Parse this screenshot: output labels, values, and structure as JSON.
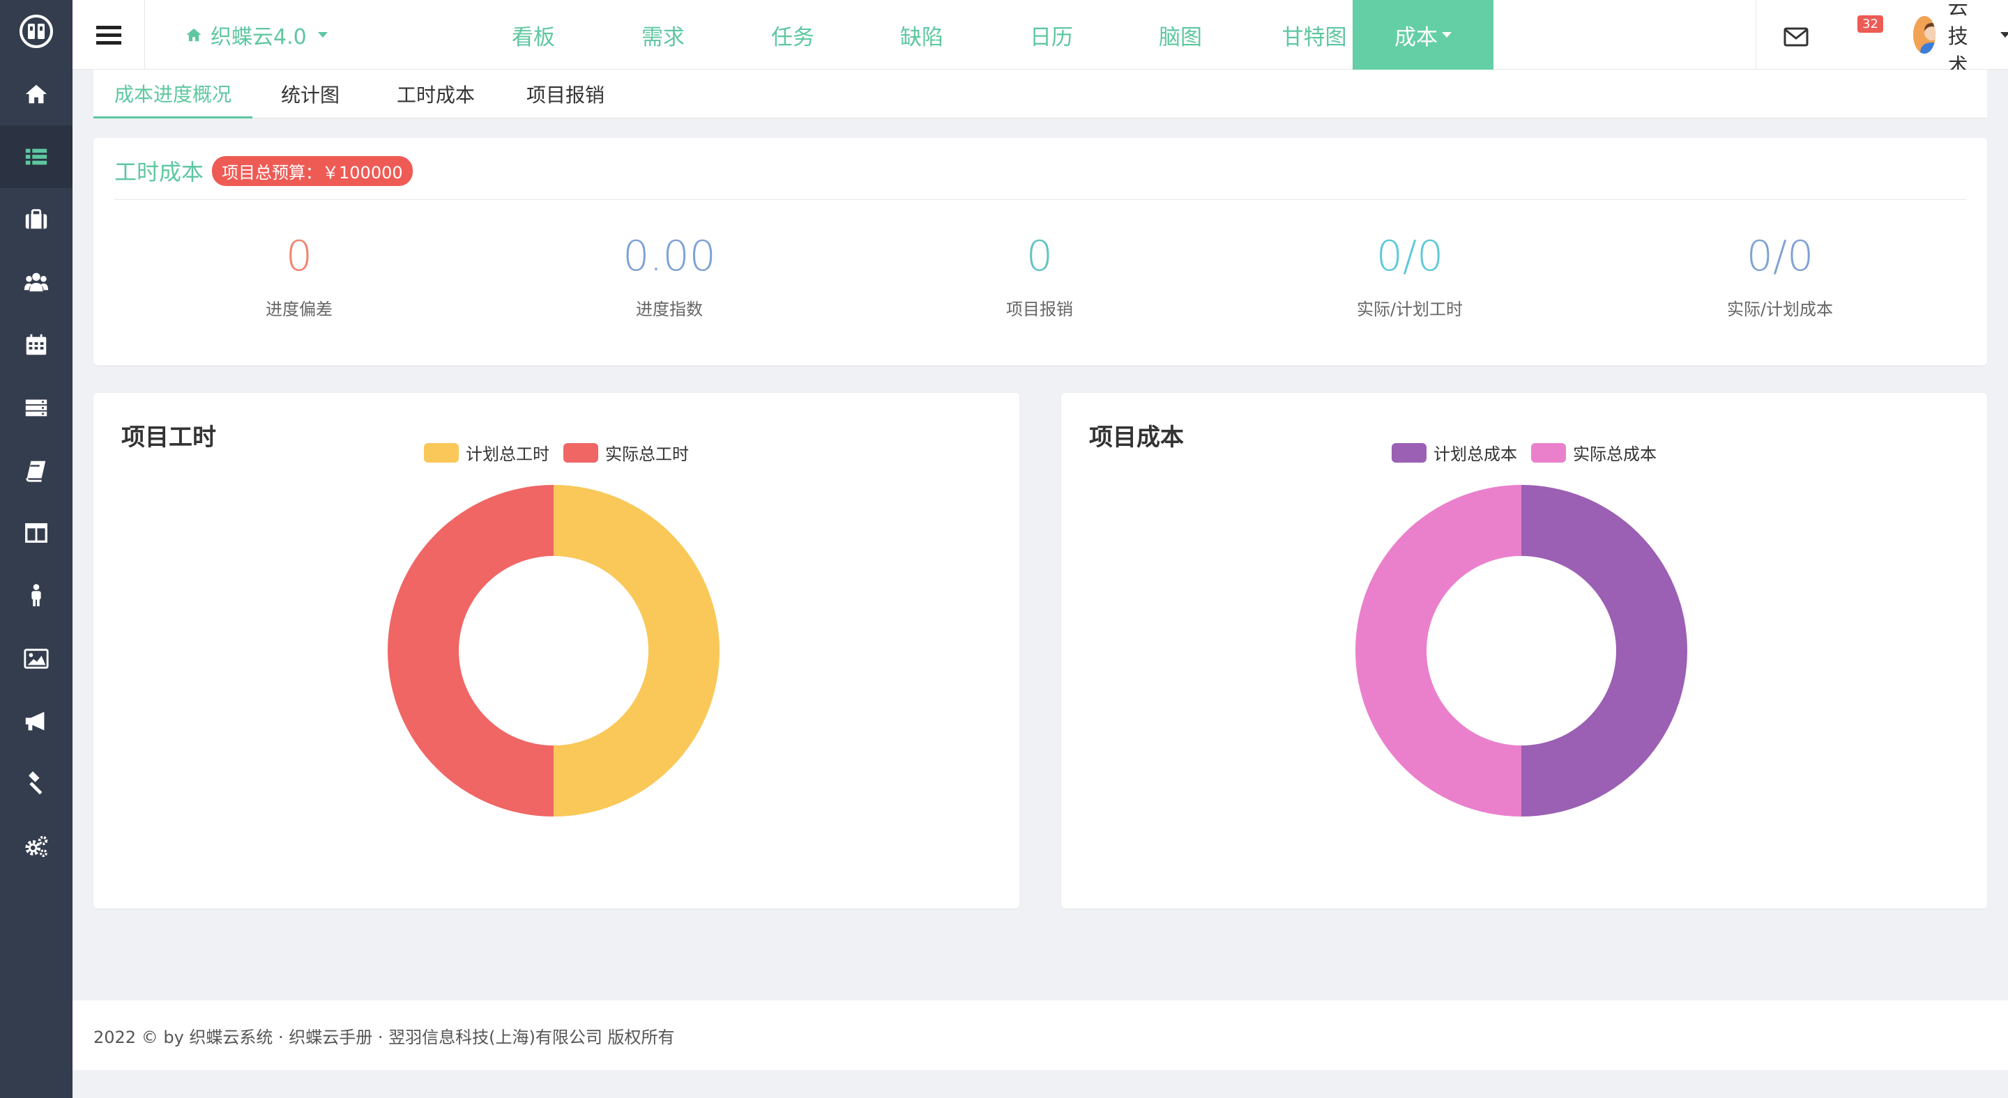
{
  "sidebar": {
    "items": [
      {
        "name": "home-icon"
      },
      {
        "name": "list-icon",
        "active": true
      },
      {
        "name": "briefcase-icon"
      },
      {
        "name": "users-icon"
      },
      {
        "name": "calendar-icon"
      },
      {
        "name": "server-icon"
      },
      {
        "name": "book-icon"
      },
      {
        "name": "columns-icon"
      },
      {
        "name": "person-icon"
      },
      {
        "name": "image-icon"
      },
      {
        "name": "megaphone-icon"
      },
      {
        "name": "gavel-icon"
      },
      {
        "name": "gears-icon"
      }
    ]
  },
  "topbar": {
    "brand": "织蝶云4.0",
    "nav": [
      "看板",
      "需求",
      "任务",
      "缺陷",
      "日历",
      "脑图",
      "甘特图",
      "成本"
    ],
    "active_nav": "成本",
    "mail_count": "32",
    "user": "云技术"
  },
  "subtabs": [
    "成本进度概况",
    "统计图",
    "工时成本",
    "项目报销"
  ],
  "stats": {
    "title": "工时成本",
    "budget": "项目总预算：￥100000",
    "items": [
      {
        "value": "0",
        "label": "进度偏差",
        "color": "#f2826f"
      },
      {
        "value": "0.00",
        "label": "进度指数",
        "color": "#7fa2d4"
      },
      {
        "value": "0",
        "label": "项目报销",
        "color": "#62c2c4"
      },
      {
        "value": "0/0",
        "label": "实际/计划工时",
        "color": "#5ec9d9"
      },
      {
        "value": "0/0",
        "label": "实际/计划成本",
        "color": "#7fa2d4"
      }
    ]
  },
  "charts": {
    "hours": {
      "title": "项目工时",
      "legend": [
        {
          "label": "计划总工时",
          "color": "#f9c858"
        },
        {
          "label": "实际总工时",
          "color": "#ef6665"
        }
      ]
    },
    "cost": {
      "title": "项目成本",
      "legend": [
        {
          "label": "计划总成本",
          "color": "#9b5fb4"
        },
        {
          "label": "实际总成本",
          "color": "#ea80cc"
        }
      ]
    }
  },
  "chart_data": [
    {
      "type": "pie",
      "title": "项目工时",
      "categories": [
        "计划总工时",
        "实际总工时"
      ],
      "values": [
        1,
        1
      ],
      "colors": [
        "#f9c858",
        "#ef6665"
      ],
      "legend": "top"
    },
    {
      "type": "pie",
      "title": "项目成本",
      "categories": [
        "计划总成本",
        "实际总成本"
      ],
      "values": [
        1,
        1
      ],
      "colors": [
        "#9b5fb4",
        "#ea80cc"
      ],
      "legend": "top"
    }
  ],
  "footer": "2022 © by 织蝶云系统 · 织蝶云手册 · 翌羽信息科技(上海)有限公司 版权所有"
}
